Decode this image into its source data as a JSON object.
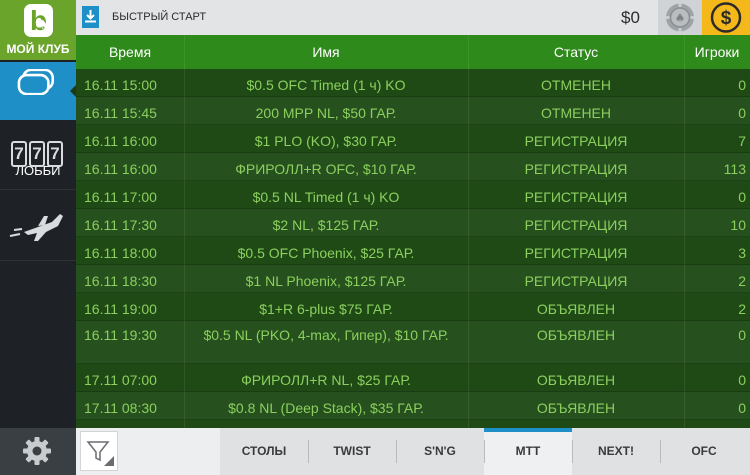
{
  "sidebar": {
    "club_label": "МОЙ КЛУБ",
    "club_logo_letter": "b",
    "lobby_label": "ЛОББИ",
    "slots_digits": [
      "7",
      "7",
      "7"
    ],
    "icons": {
      "club": "club-logo-icon",
      "lobby": "lobby-icon",
      "slots": "slots-777-icon",
      "plane": "airplane-icon",
      "settings": "gear-icon"
    }
  },
  "topbar": {
    "quick_start_label": "БЫСТРЫЙ СТАРТ",
    "balance": "$0",
    "coin_symbol": "$"
  },
  "table": {
    "columns": [
      "Время",
      "Имя",
      "Статус",
      "Игроки"
    ],
    "rows": [
      {
        "time": "16.11 15:00",
        "name": "$0.5 OFC Timed (1 ч) KO",
        "status": "ОТМЕНЕН",
        "players": "0"
      },
      {
        "time": "16.11 15:45",
        "name": "200 MPP NL, $50 ГАР.",
        "status": "ОТМЕНЕН",
        "players": "0"
      },
      {
        "time": "16.11 16:00",
        "name": "$1 PLO (KO), $30 ГАР.",
        "status": "РЕГИСТРАЦИЯ",
        "players": "7"
      },
      {
        "time": "16.11 16:00",
        "name": "ФРИРОЛЛ+R OFC, $10 ГАР.",
        "status": "РЕГИСТРАЦИЯ",
        "players": "113"
      },
      {
        "time": "16.11 17:00",
        "name": "$0.5 NL Timed (1 ч) KO",
        "status": "РЕГИСТРАЦИЯ",
        "players": "0"
      },
      {
        "time": "16.11 17:30",
        "name": "$2 NL, $125 ГАР.",
        "status": "РЕГИСТРАЦИЯ",
        "players": "10"
      },
      {
        "time": "16.11 18:00",
        "name": "$0.5 OFC Phoenix, $25 ГАР.",
        "status": "РЕГИСТРАЦИЯ",
        "players": "3"
      },
      {
        "time": "16.11 18:30",
        "name": "$1 NL Phoenix, $125 ГАР.",
        "status": "РЕГИСТРАЦИЯ",
        "players": "2"
      },
      {
        "time": "16.11 19:00",
        "name": "$1+R 6-plus $75 ГАР.",
        "status": "ОБЪЯВЛЕН",
        "players": "2"
      },
      {
        "time": "16.11 19:30",
        "name": "$0.5 NL (PKO, 4-max, Гипер), $10 ГАР.",
        "status": "ОБЪЯВЛЕН",
        "players": "0"
      },
      {
        "time": "17.11 07:00",
        "name": "ФРИРОЛЛ+R NL, $25 ГАР.",
        "status": "ОБЪЯВЛЕН",
        "players": "0"
      },
      {
        "time": "17.11 08:30",
        "name": "$0.8 NL (Deep Stack), $35 ГАР.",
        "status": "ОБЪЯВЛЕН",
        "players": "0"
      },
      {
        "time": "",
        "name": "",
        "status": "",
        "players": ""
      }
    ]
  },
  "bottombar": {
    "tabs": [
      {
        "label": "СТОЛЫ",
        "active": false
      },
      {
        "label": "TWIST",
        "active": false
      },
      {
        "label": "S'N'G",
        "active": false
      },
      {
        "label": "MTT",
        "active": true
      },
      {
        "label": "NEXT!",
        "active": false
      },
      {
        "label": "OFC",
        "active": false
      }
    ]
  },
  "colors": {
    "accent_blue": "#1f8fc7",
    "club_green": "#6aa42a",
    "header_green": "#2f8a1c",
    "row_text_green": "#8bd05e",
    "coin_yellow": "#f5b81a"
  }
}
